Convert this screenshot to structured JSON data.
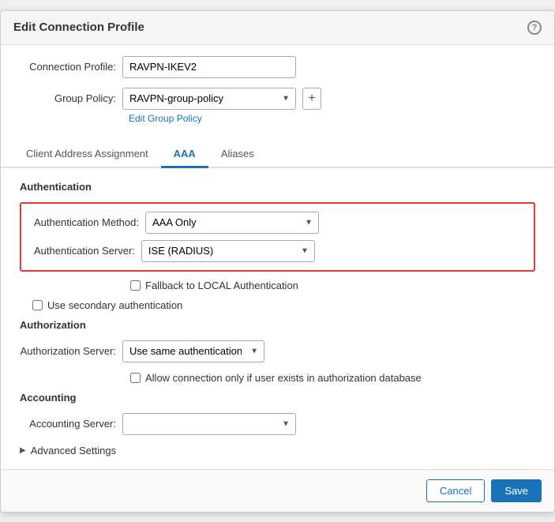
{
  "dialog": {
    "title": "Edit Connection Profile",
    "help_icon": "?"
  },
  "form": {
    "connection_profile_label": "Connection Profile:",
    "connection_profile_value": "RAVPN-IKEV2",
    "group_policy_label": "Group Policy:",
    "group_policy_value": "RAVPN-group-policy",
    "edit_group_policy_link": "Edit Group Policy"
  },
  "tabs": [
    {
      "label": "Client Address Assignment",
      "active": false
    },
    {
      "label": "AAA",
      "active": true
    },
    {
      "label": "Aliases",
      "active": false
    }
  ],
  "authentication": {
    "section_title": "Authentication",
    "method_label": "Authentication Method:",
    "method_value": "AAA Only",
    "server_label": "Authentication Server:",
    "server_value": "ISE (RADIUS)",
    "fallback_label": "Fallback to LOCAL Authentication",
    "use_secondary_label": "Use secondary authentication"
  },
  "authorization": {
    "section_title": "Authorization",
    "server_label": "Authorization Server:",
    "server_value": "Use same authentication server",
    "allow_label": "Allow connection only if user exists in authorization database"
  },
  "accounting": {
    "section_title": "Accounting",
    "server_label": "Accounting Server:",
    "server_value": ""
  },
  "advanced": {
    "label": "Advanced Settings"
  },
  "footer": {
    "cancel_label": "Cancel",
    "save_label": "Save"
  }
}
